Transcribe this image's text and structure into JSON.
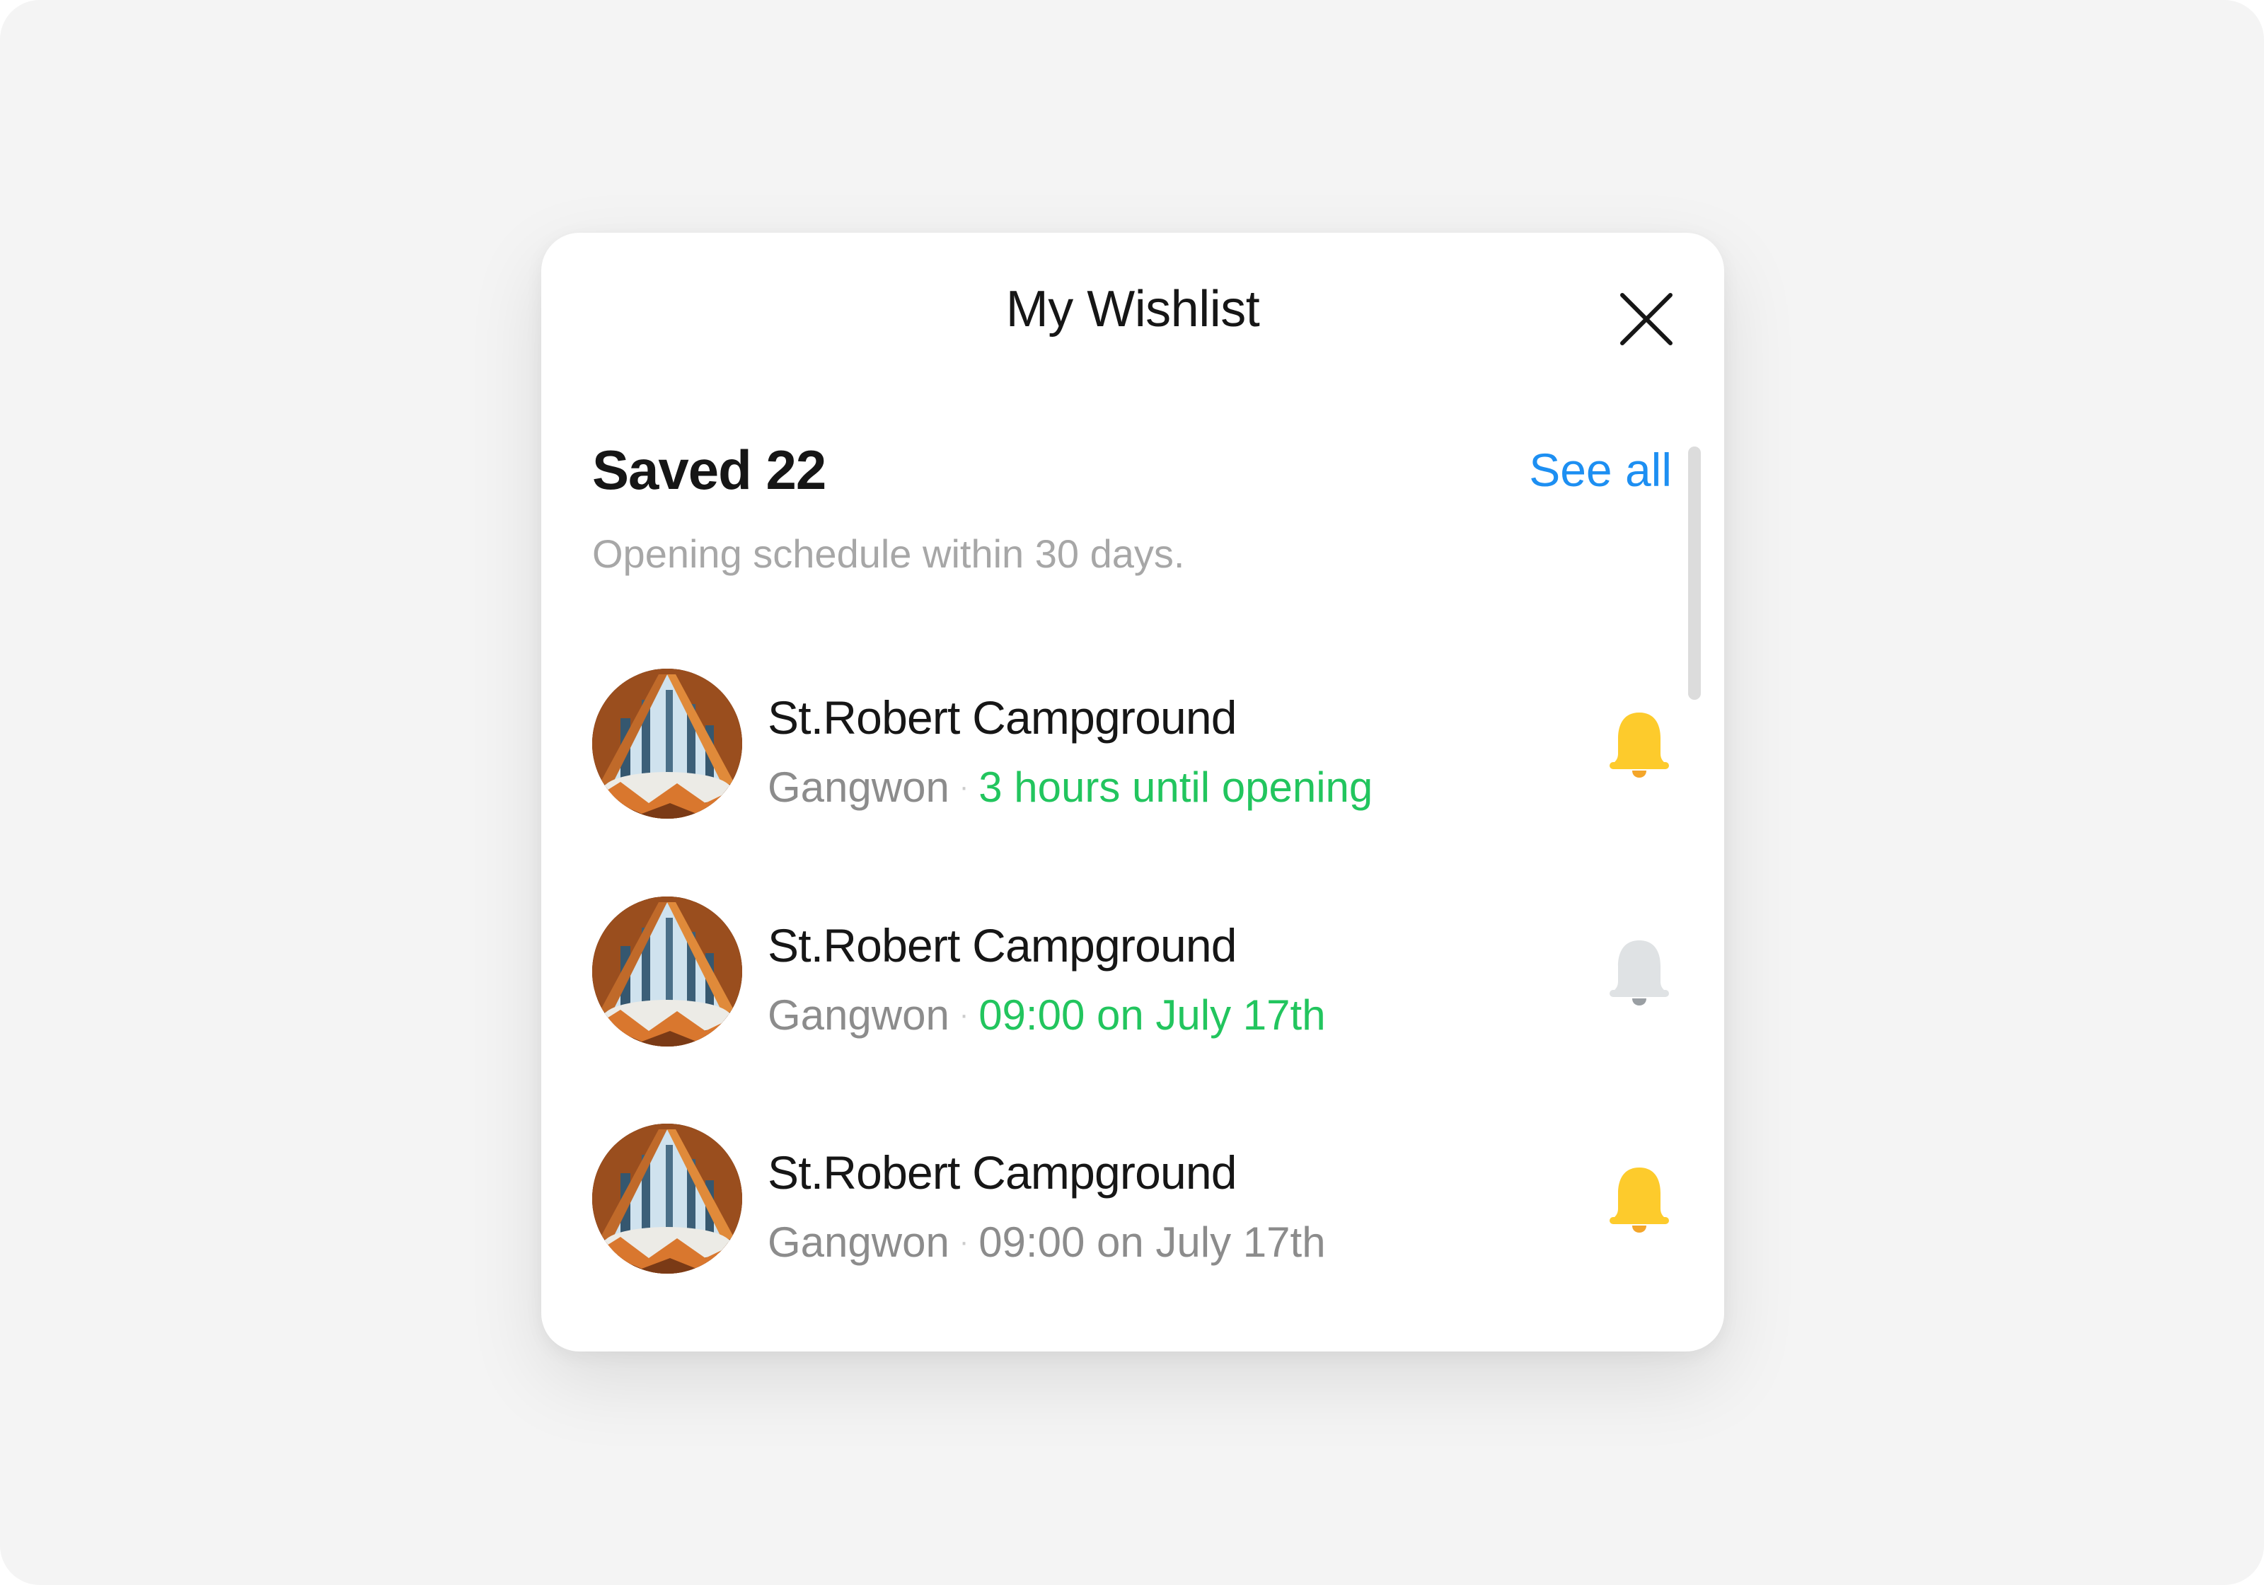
{
  "modal": {
    "title": "My Wishlist",
    "close_icon": "close-icon"
  },
  "wishlist": {
    "saved_label": "Saved 22",
    "see_all_label": "See all",
    "subtitle": "Opening schedule within 30 days."
  },
  "items": [
    {
      "name": "St.Robert Campground",
      "location": "Gangwon",
      "separator": "·",
      "status": "3 hours until opening",
      "status_color": "#22c55e",
      "bell_icon": "bell-icon",
      "notification_on": true,
      "bell_color": "#fdcb2c"
    },
    {
      "name": "St.Robert Campground",
      "location": "Gangwon",
      "separator": "·",
      "status": "09:00 on July 17th",
      "status_color": "#22c55e",
      "bell_icon": "bell-icon",
      "notification_on": false,
      "bell_color": "#dfe2e4"
    },
    {
      "name": "St.Robert Campground",
      "location": "Gangwon",
      "separator": "·",
      "status": "09:00 on July 17th",
      "status_color": "#8c8c8c",
      "bell_icon": "bell-icon",
      "notification_on": true,
      "bell_color": "#fdcb2c"
    }
  ],
  "colors": {
    "accent_blue": "#1d8ff2",
    "status_green": "#22c55e",
    "bell_active": "#fdcb2c",
    "bell_inactive": "#dfe2e4"
  }
}
